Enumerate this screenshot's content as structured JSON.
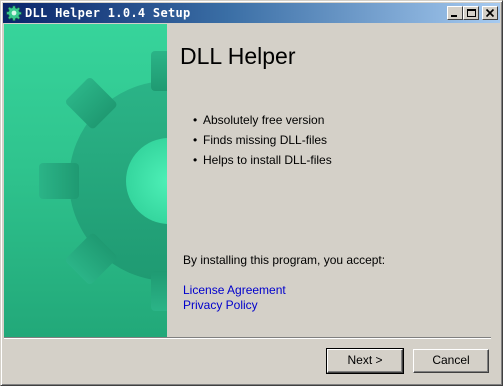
{
  "window": {
    "title": "DLL Helper 1.0.4 Setup",
    "icon": "gear-icon"
  },
  "titlebar_buttons": {
    "minimize": "minimize-icon",
    "maximize": "maximize-icon",
    "close": "close-icon"
  },
  "sidebar": {
    "graphic": "gear-icon",
    "colors": {
      "light": "#37d49b",
      "dark": "#22a879"
    }
  },
  "main": {
    "title": "DLL Helper",
    "features": [
      "Absolutely free version",
      "Finds missing DLL-files",
      "Helps to install DLL-files"
    ],
    "accept_text": "By installing this program, you accept:",
    "links": {
      "license": "License Agreement",
      "privacy": "Privacy Policy"
    },
    "link_color": "#0000cc"
  },
  "footer": {
    "next_label": "Next >",
    "cancel_label": "Cancel"
  }
}
